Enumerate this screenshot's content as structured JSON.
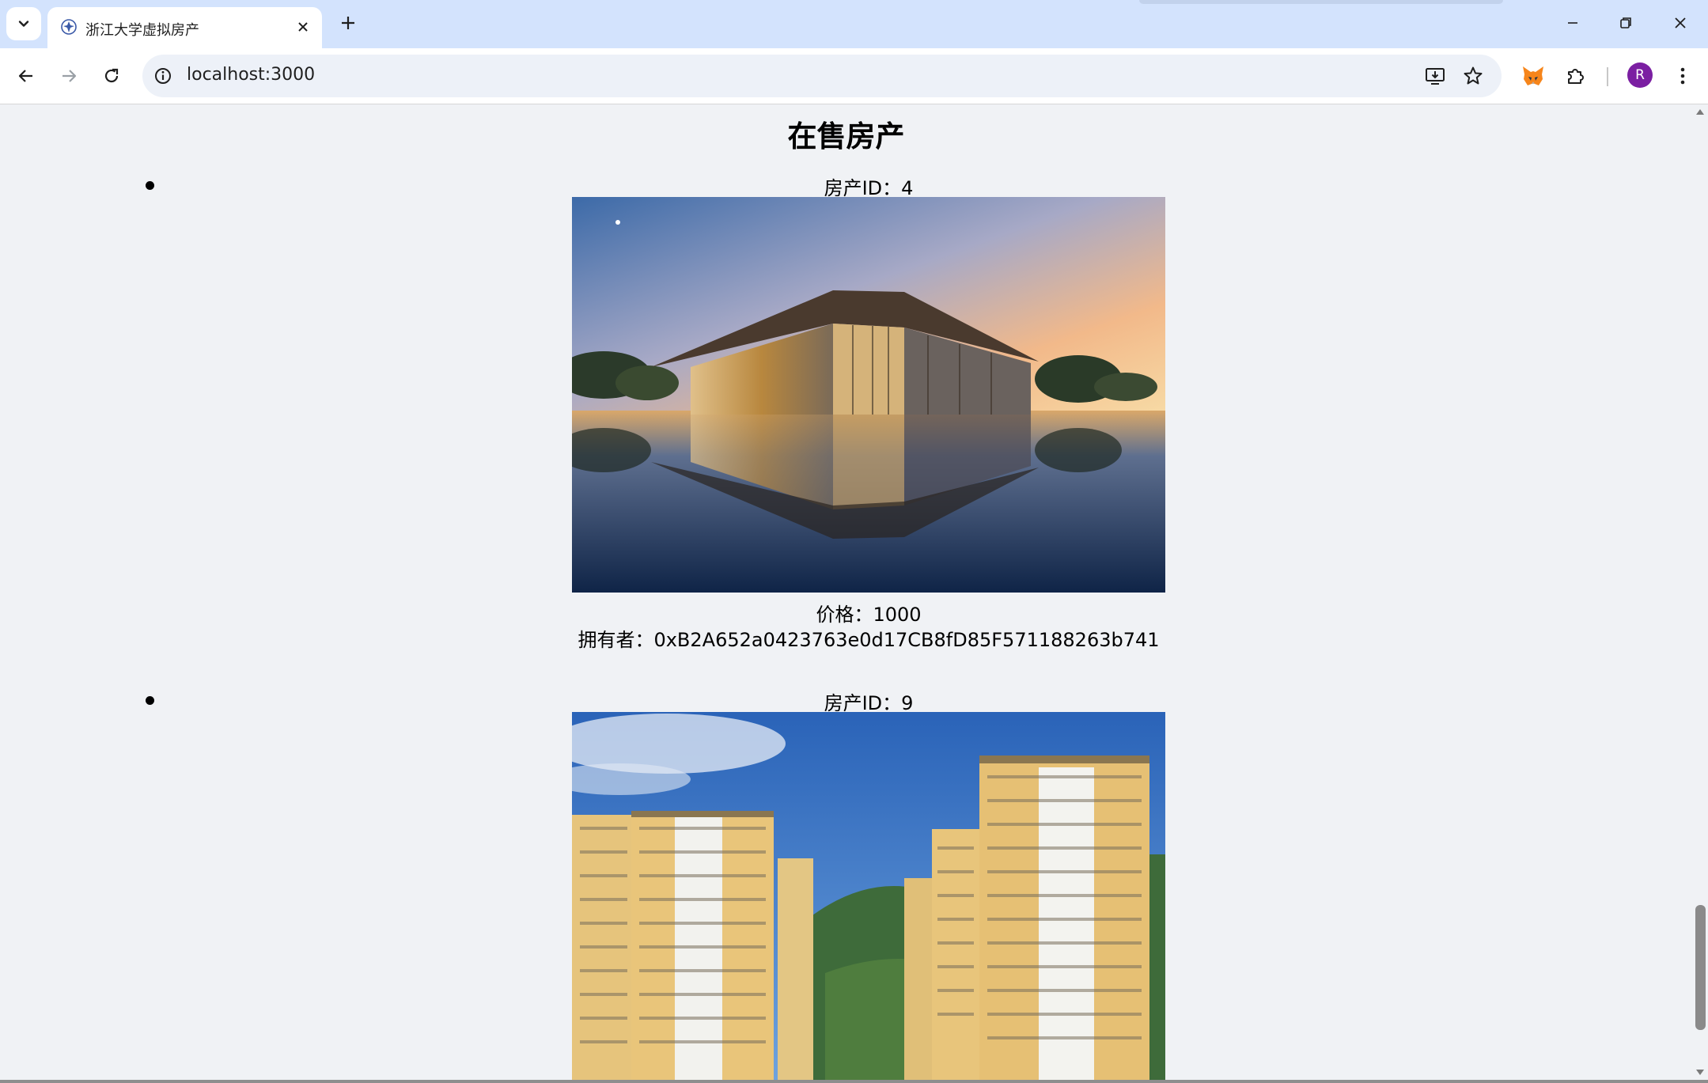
{
  "browser": {
    "tab_title": "浙江大学虚拟房产",
    "url": "localhost:3000",
    "profile_initial": "R"
  },
  "page": {
    "title": "在售房产"
  },
  "properties": [
    {
      "id_text": "房产ID：4",
      "image_alt": "glass pavilion reflected in water at sunset",
      "price_text": "价格：1000",
      "owner_text": "拥有者：0xB2A652a0423763e0d17CB8fD85F571188263b741"
    },
    {
      "id_text": "房产ID：9",
      "image_alt": "residential high-rise towers under blue sky"
    }
  ],
  "colors": {
    "tabbar": "#d3e3fd",
    "page_background": "#f0f2f5",
    "profile_avatar": "#7b1fa2"
  },
  "icons": [
    "tab-search-icon",
    "favicon-icon",
    "close-icon",
    "new-tab-icon",
    "minimize-icon",
    "restore-icon",
    "window-close-icon",
    "back-icon",
    "forward-icon",
    "reload-icon",
    "site-info-icon",
    "install-app-icon",
    "bookmark-star-icon",
    "metamask-fox-icon",
    "extensions-puzzle-icon",
    "more-menu-icon"
  ]
}
